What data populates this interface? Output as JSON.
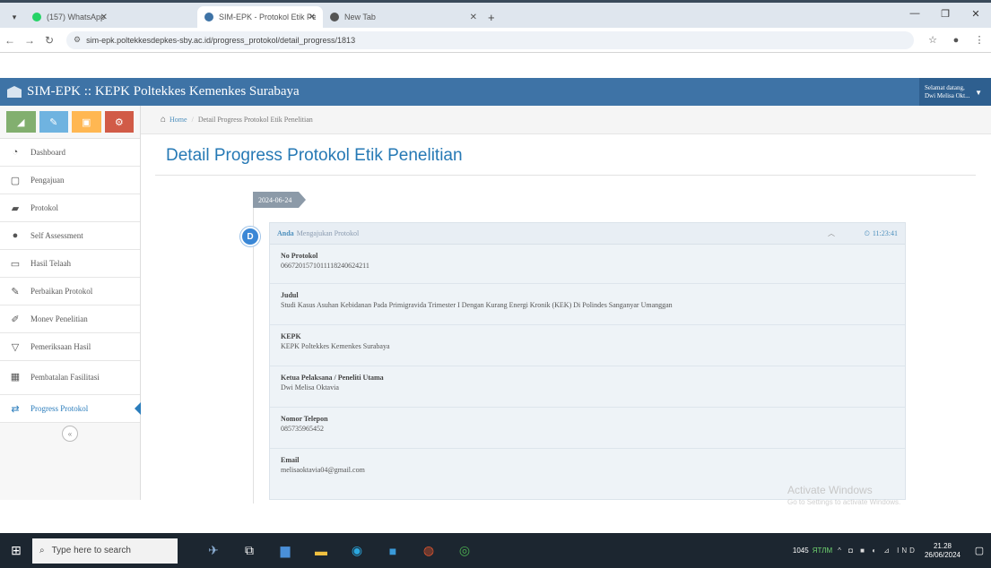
{
  "browser": {
    "tabs": [
      {
        "label": "(157) WhatsApp",
        "active": false,
        "favicon_color": "#25d366"
      },
      {
        "label": "SIM-EPK - Protokol Etik Peneliti",
        "active": true,
        "favicon_color": "#3e73a6"
      },
      {
        "label": "New Tab",
        "active": false,
        "favicon_color": "#555555"
      }
    ],
    "url": "sim-epk.poltekkesdepkes-sby.ac.id/progress_protokol/detail_progress/1813"
  },
  "app": {
    "brand": "SIM-EPK :: KEPK Poltekkes Kemenkes Surabaya",
    "user_line1": "Selamat datang,",
    "user_line2": "Dwi Melisa Okt..."
  },
  "sidebar": {
    "items": [
      {
        "label": "Dashboard",
        "icon": "tachometer-icon"
      },
      {
        "label": "Pengajuan",
        "icon": "file-icon"
      },
      {
        "label": "Protokol",
        "icon": "book-icon"
      },
      {
        "label": "Self Assessment",
        "icon": "circle-icon"
      },
      {
        "label": "Hasil Telaah",
        "icon": "desktop-icon"
      },
      {
        "label": "Perbaikan Protokol",
        "icon": "edit-icon"
      },
      {
        "label": "Monev Penelitian",
        "icon": "pencil-icon"
      },
      {
        "label": "Pemeriksaan Hasil",
        "icon": "filter-icon"
      },
      {
        "label": "Pembatalan Fasilitasi",
        "icon": "table-icon"
      },
      {
        "label": "Progress Protokol",
        "icon": "exchange-icon"
      }
    ]
  },
  "breadcrumbs": {
    "home": "Home",
    "current": "Detail Progress Protokol Etik Penelitian"
  },
  "page": {
    "title": "Detail Progress Protokol Etik Penelitian"
  },
  "timeline": {
    "date": "2024-06-24",
    "icon_letter": "D",
    "who": "Anda",
    "action": "Mengajukan Protokol",
    "time": "11:23:41",
    "fields": [
      {
        "label": "No Protokol",
        "value": "0667201571011118240624211"
      },
      {
        "label": "Judul",
        "value": "Studi Kasus Asuhan Kebidanan Pada Primigravida Trimester I Dengan Kurang Energi Kronik (KEK) Di Polindes Sanganyar Umanggan"
      },
      {
        "label": "KEPK",
        "value": "KEPK Poltekkes Kemenkes Surabaya"
      },
      {
        "label": "Ketua Pelaksana / Peneliti Utama",
        "value": "Dwi Melisa Oktavia"
      },
      {
        "label": "Nomor Telepon",
        "value": "085735965452"
      },
      {
        "label": "Email",
        "value": "melisaoktavia04@gmail.com"
      }
    ]
  },
  "windows_watermark": {
    "line1": "Activate Windows",
    "line2": "Go to Settings to activate Windows."
  },
  "taskbar": {
    "search_placeholder": "Type here to search",
    "weather": "1045",
    "weather_status": "ЯТЛМ",
    "time": "21.28",
    "date": "26/06/2024",
    "tray": "^ ◘ ■ ◐ ⊿ IND"
  }
}
